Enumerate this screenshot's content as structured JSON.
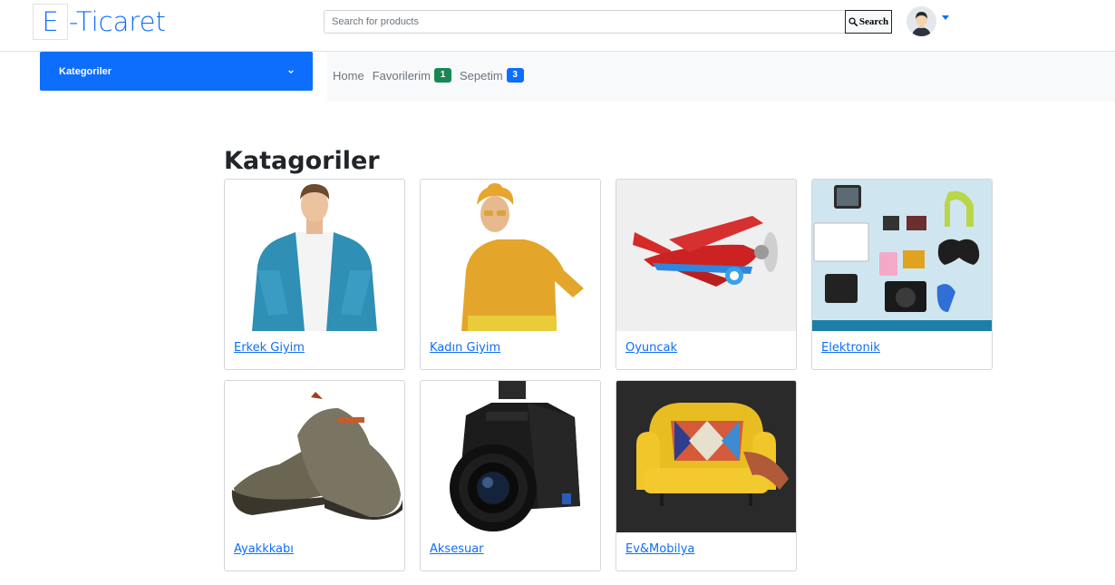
{
  "header": {
    "logo_letter": "E",
    "logo_rest": "-Ticaret",
    "search_placeholder": "Search for products",
    "search_button": "Search"
  },
  "nav": {
    "categories_label": "Kategoriler",
    "links": [
      {
        "label": "Home"
      },
      {
        "label": "Favorilerim",
        "badge": "1"
      },
      {
        "label": "Sepetim",
        "badge": "3"
      }
    ]
  },
  "main": {
    "title": "Katagoriler",
    "categories": [
      {
        "name": "Erkek Giyim"
      },
      {
        "name": "Kadın Giyim"
      },
      {
        "name": "Oyuncak"
      },
      {
        "name": "Elektronik"
      },
      {
        "name": "Ayakkkabı"
      },
      {
        "name": "Aksesuar"
      },
      {
        "name": "Ev&Mobilya"
      }
    ]
  },
  "colors": {
    "primary": "#0d6efd",
    "success": "#198754",
    "nav_bg": "#f8f9fa"
  },
  "icons": [
    "search-icon",
    "user-avatar",
    "caret-down-icon",
    "chevron-down-icon"
  ]
}
